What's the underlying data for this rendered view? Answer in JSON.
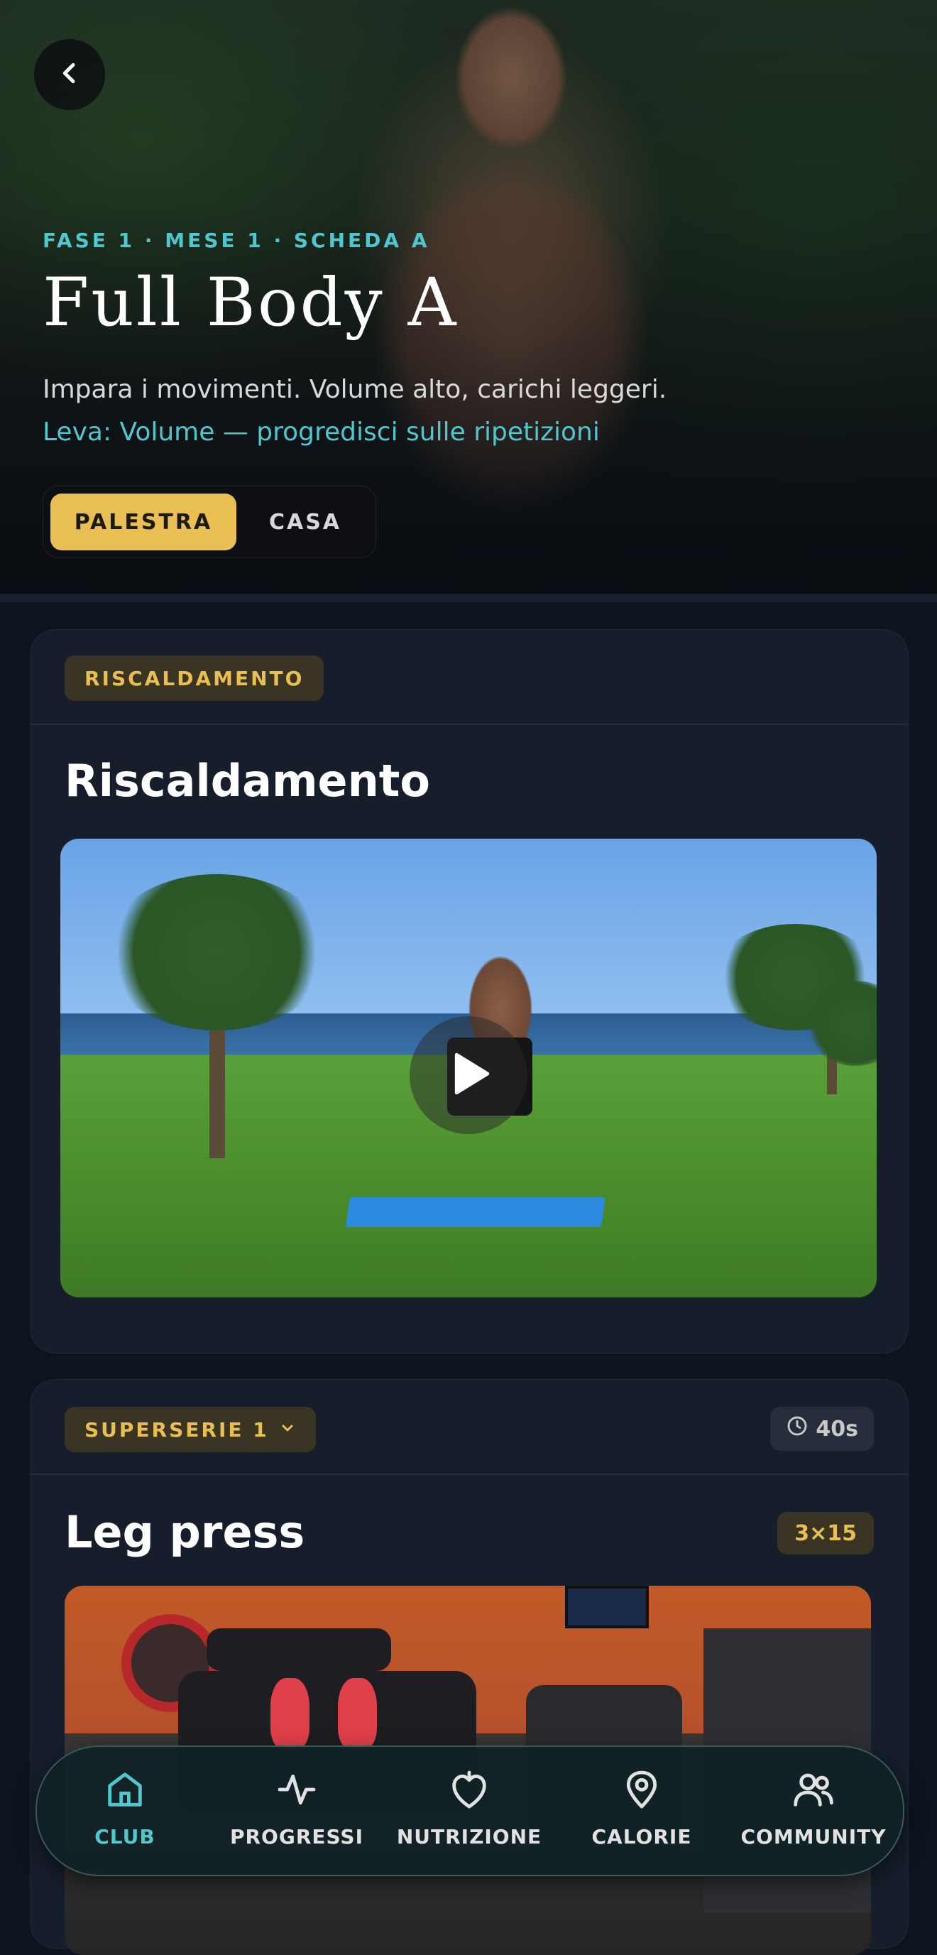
{
  "header": {
    "phase_label": "FASE 1 · MESE 1 · SCHEDA A",
    "title": "Full Body A",
    "subtitle": "Impara i movimenti. Volume alto, carichi leggeri.",
    "lever": "Leva: Volume — progredisci sulle ripetizioni",
    "toggle": {
      "active": "PALESTRA",
      "inactive": "CASA"
    }
  },
  "warmup": {
    "tag": "RISCALDAMENTO",
    "title": "Riscaldamento"
  },
  "superset": {
    "tag": "SUPERSERIE 1",
    "rest": "40s",
    "exercise_title": "Leg press",
    "sets_reps": "3×15"
  },
  "bottom_nav": {
    "items": [
      {
        "label": "CLUB",
        "icon": "home-icon",
        "active": true
      },
      {
        "label": "PROGRESSI",
        "icon": "activity-icon",
        "active": false
      },
      {
        "label": "NUTRIZIONE",
        "icon": "apple-icon",
        "active": false
      },
      {
        "label": "CALORIE",
        "icon": "map-pin-icon",
        "active": false
      },
      {
        "label": "COMMUNITY",
        "icon": "users-icon",
        "active": false
      }
    ]
  },
  "colors": {
    "accent_teal": "#4fc7cf",
    "accent_gold": "#e9bf54",
    "background": "#0d1420",
    "card": "#161e2c"
  }
}
